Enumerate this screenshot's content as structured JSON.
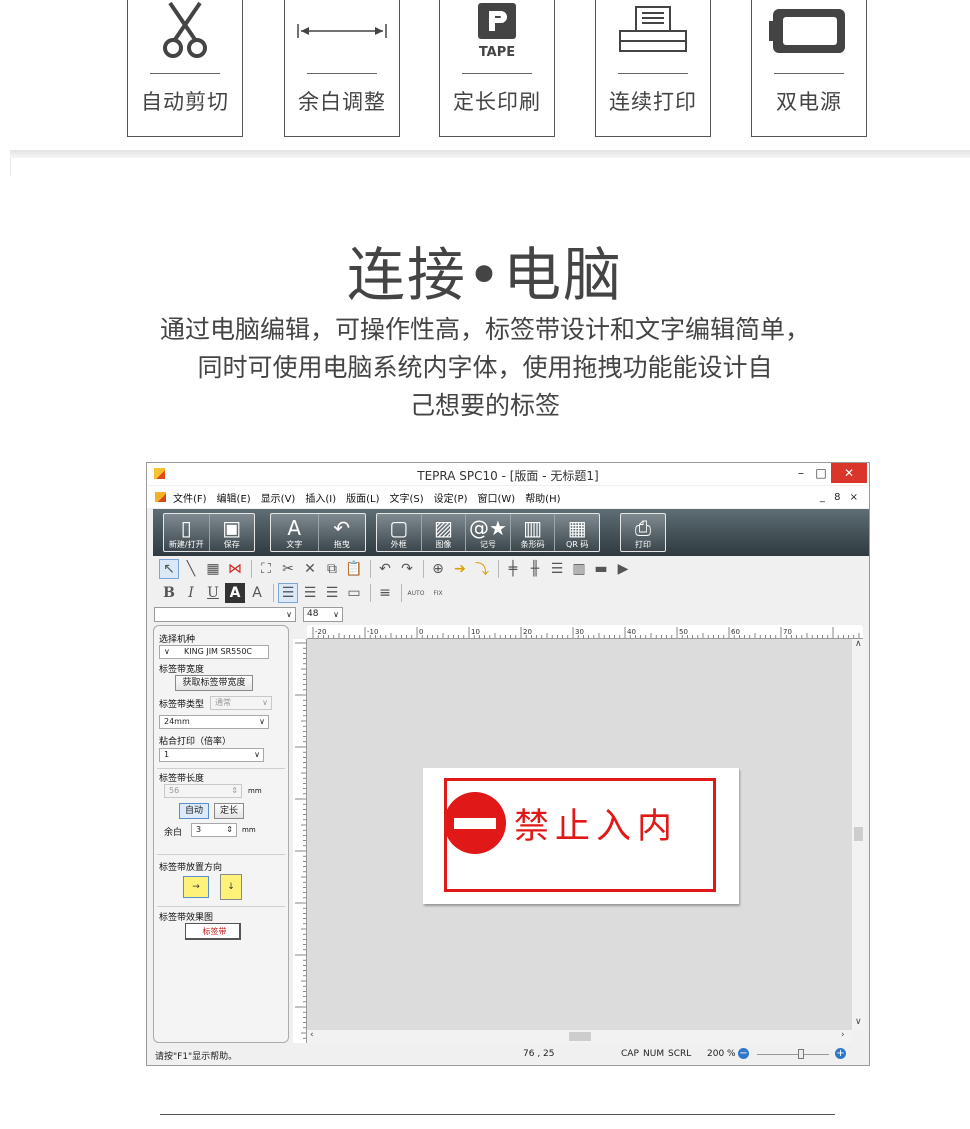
{
  "features": [
    {
      "label": "自动剪切",
      "icon": "scissors-icon"
    },
    {
      "label": "余白调整",
      "icon": "margin-arrows-icon"
    },
    {
      "label": "定长印刷",
      "icon": "tape-icon",
      "icon_text": "TAPE"
    },
    {
      "label": "连续打印",
      "icon": "printer-icon"
    },
    {
      "label": "双电源",
      "icon": "battery-icon"
    }
  ],
  "heading": "连接•电脑",
  "description_lines": [
    "通过电脑编辑，可操作性高，标签带设计和文字编辑简单，",
    "同时可使用电脑系统内字体，使用拖拽功能能设计自",
    "己想要的标签"
  ],
  "window": {
    "title": "TEPRA SPC10 - [版面  - 无标题1]",
    "controls": {
      "minimize": "–",
      "maximize": "□",
      "close": "✕"
    },
    "menu": [
      "文件(F)",
      "编辑(E)",
      "显示(V)",
      "插入(I)",
      "版面(L)",
      "文字(S)",
      "设定(P)",
      "窗口(W)",
      "帮助(H)"
    ],
    "mdi_controls": "_ 8 ×",
    "big_toolbar": [
      {
        "label": "新建/打开",
        "icon": "new-open-icon"
      },
      {
        "label": "保存",
        "icon": "save-icon"
      },
      {
        "label": "文字",
        "icon": "text-icon",
        "glyph": "A"
      },
      {
        "label": "拖曳",
        "icon": "drag-icon"
      },
      {
        "label": "外框",
        "icon": "frame-icon"
      },
      {
        "label": "图像",
        "icon": "image-icon"
      },
      {
        "label": "记号",
        "icon": "symbol-icon"
      },
      {
        "label": "条形码",
        "icon": "barcode-icon"
      },
      {
        "label": "QR 码",
        "icon": "qr-code-icon"
      },
      {
        "label": "打印",
        "icon": "print-icon"
      }
    ],
    "format_bar": {
      "bold": "B",
      "italic": "I",
      "underline": "U",
      "invert": "A",
      "font_a": "A",
      "auto": "AUTO",
      "fix": "FIX"
    },
    "font_combo": "",
    "font_size": "48",
    "ruler_labels": [
      "-20",
      "-10",
      "0",
      "10",
      "20",
      "30",
      "40",
      "50",
      "60",
      "70"
    ],
    "panel": {
      "model_label": "选择机种",
      "model_value": "KING JIM SR550C",
      "tape_width_label": "标签带宽度",
      "get_width_button": "获取标签带宽度",
      "tape_type_label": "标签带类型",
      "tape_type_value": "通常",
      "tape_size_value": "24mm",
      "paste_print_label": "粘合打印（倍率）",
      "paste_print_value": "1",
      "tape_length_label": "标签带长度",
      "tape_length_value": "56",
      "unit": "mm",
      "auto_button": "自动",
      "fixed_button": "定长",
      "margin_label": "余白",
      "margin_value": "3",
      "direction_label": "标签带放置方向",
      "direction_h": "→",
      "direction_v": "↓",
      "preview_label": "标签带效果图",
      "preview_value": "标签带"
    },
    "canvas_label_text": "禁止入内",
    "status": {
      "help": "请按\"F1\"显示帮助。",
      "coords": "76 , 25",
      "cap": "CAP",
      "num": "NUM",
      "scrl": "SCRL",
      "zoom": "200 %"
    }
  },
  "colors": {
    "sign_red": "#e01818",
    "close_red": "#d9352b"
  }
}
